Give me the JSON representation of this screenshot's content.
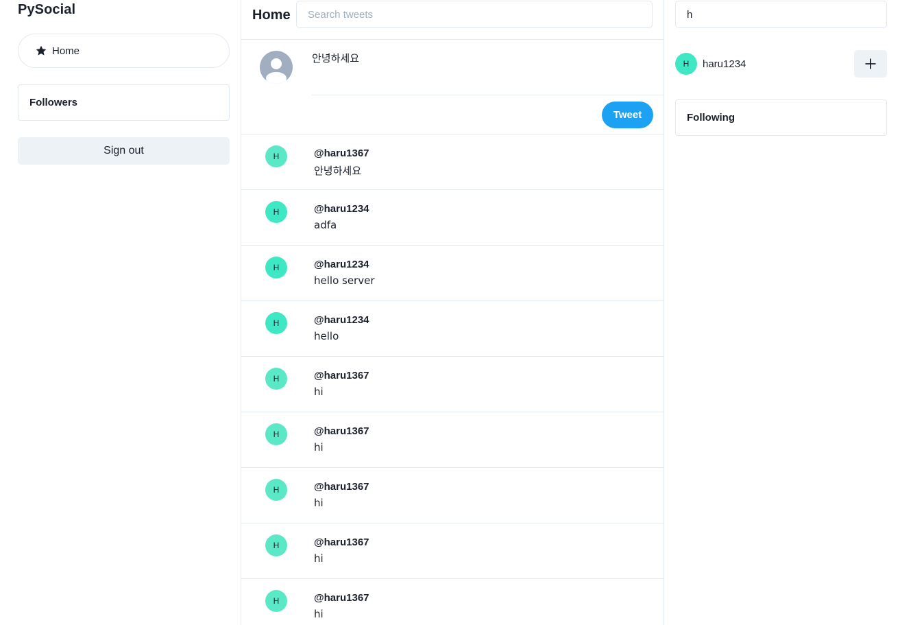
{
  "app": {
    "title": "PySocial"
  },
  "sidebar": {
    "home_label": "Home",
    "followers_title": "Followers",
    "signout_label": "Sign out"
  },
  "header": {
    "title": "Home",
    "search_placeholder": "Search tweets"
  },
  "composer": {
    "value": "안녕하세요",
    "tweet_label": "Tweet"
  },
  "feed": [
    {
      "initial": "H",
      "handle": "@haru1367",
      "text": "안녕하세요",
      "color": "#5ae8c6"
    },
    {
      "initial": "H",
      "handle": "@haru1234",
      "text": "adfa",
      "color": "#3ee8c4"
    },
    {
      "initial": "H",
      "handle": "@haru1234",
      "text": "hello server",
      "color": "#3ee8c4"
    },
    {
      "initial": "H",
      "handle": "@haru1234",
      "text": "hello",
      "color": "#3ee8c4"
    },
    {
      "initial": "H",
      "handle": "@haru1367",
      "text": "hi",
      "color": "#5ae8c6"
    },
    {
      "initial": "H",
      "handle": "@haru1367",
      "text": "hi",
      "color": "#5ae8c6"
    },
    {
      "initial": "H",
      "handle": "@haru1367",
      "text": "hi",
      "color": "#5ae8c6"
    },
    {
      "initial": "H",
      "handle": "@haru1367",
      "text": "hi",
      "color": "#5ae8c6"
    },
    {
      "initial": "H",
      "handle": "@haru1367",
      "text": "hi",
      "color": "#5ae8c6"
    }
  ],
  "right": {
    "search_value": "h",
    "suggestion": {
      "initial": "H",
      "name": "haru1234",
      "color": "#3ee8c4"
    },
    "following_title": "Following"
  },
  "colors": {
    "accent": "#1da1f2",
    "border": "#e2e8f0",
    "button_bg": "#edf2f7"
  }
}
